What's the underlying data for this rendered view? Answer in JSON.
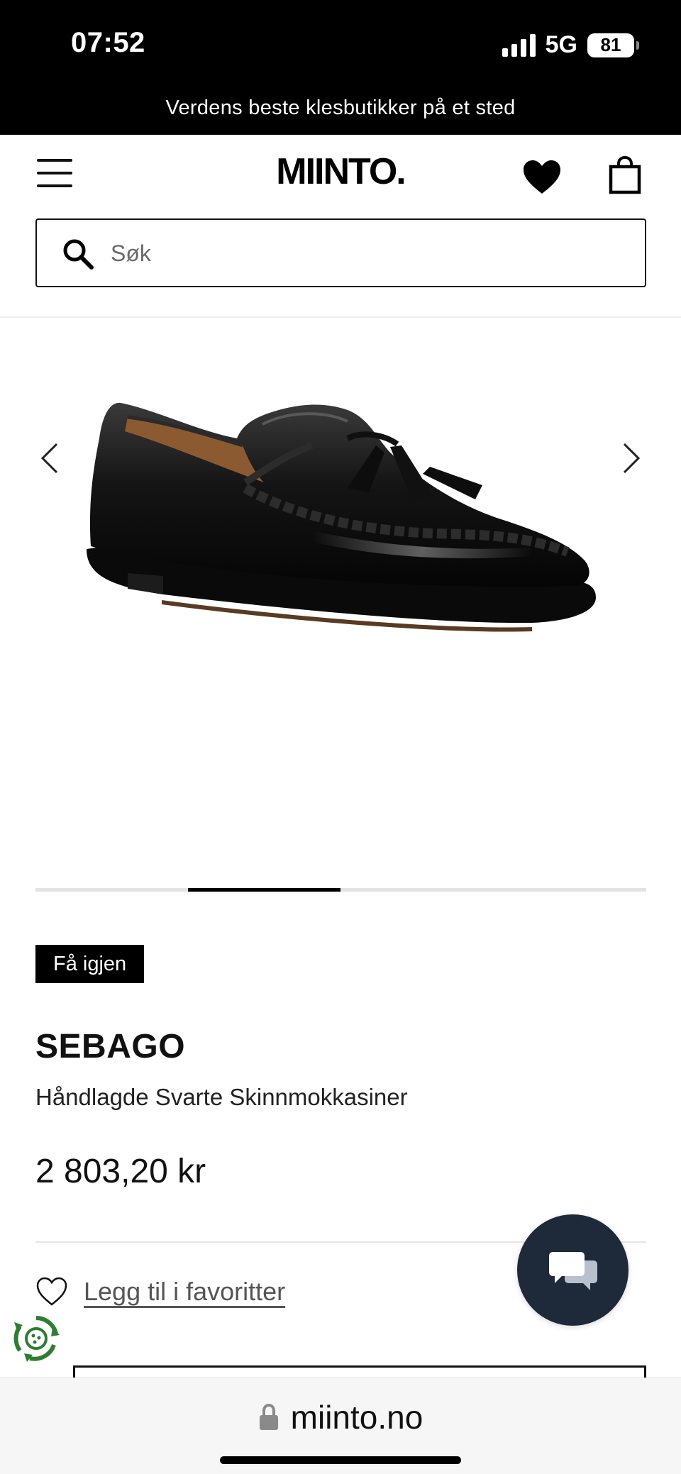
{
  "status_bar": {
    "time": "07:52",
    "network": "5G",
    "battery": "81"
  },
  "promo": {
    "text": "Verdens beste klesbutikker på et sted"
  },
  "header": {
    "logo": "MIINTO."
  },
  "search": {
    "placeholder": "Søk"
  },
  "gallery": {
    "image_icon": "loafer-shoe-image",
    "current_slide": 2,
    "total_slides": 4
  },
  "product": {
    "badge": "Få igjen",
    "brand": "SEBAGO",
    "name": "Håndlagde Svarte Skinnmokkasiner",
    "price": "2 803,20 kr",
    "favorite_label": "Legg til i favoritter"
  },
  "browser": {
    "url": "miinto.no"
  },
  "colors": {
    "bar_background": "#000000",
    "chat_button": "#1e2a3a",
    "cookie_icon": "#2e7d32"
  }
}
